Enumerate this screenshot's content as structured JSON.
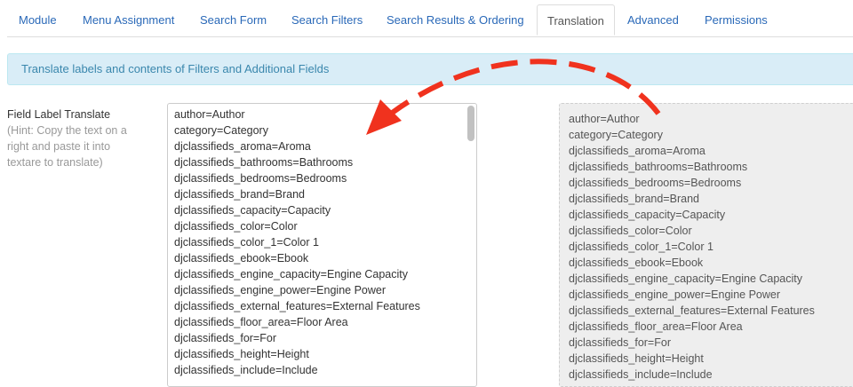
{
  "tabs": [
    {
      "label": "Module"
    },
    {
      "label": "Menu Assignment"
    },
    {
      "label": "Search Form"
    },
    {
      "label": "Search Filters"
    },
    {
      "label": "Search Results & Ordering"
    },
    {
      "label": "Translation"
    },
    {
      "label": "Advanced"
    },
    {
      "label": "Permissions"
    }
  ],
  "active_tab": "Translation",
  "alert": {
    "text": "Translate labels and contents of Filters and Additional Fields"
  },
  "field": {
    "label": "Field Label Translate",
    "hint_lines": [
      "(Hint: Copy the text on a",
      "right and paste it into",
      "textare to translate)"
    ]
  },
  "textarea_lines": [
    "author=Author",
    "category=Category",
    "djclassifieds_aroma=Aroma",
    "djclassifieds_bathrooms=Bathrooms",
    "djclassifieds_bedrooms=Bedrooms",
    "djclassifieds_brand=Brand",
    "djclassifieds_capacity=Capacity",
    "djclassifieds_color=Color",
    "djclassifieds_color_1=Color 1",
    "djclassifieds_ebook=Ebook",
    "djclassifieds_engine_capacity=Engine Capacity",
    "djclassifieds_engine_power=Engine Power",
    "djclassifieds_external_features=External Features",
    "djclassifieds_floor_area=Floor Area",
    "djclassifieds_for=For",
    "djclassifieds_height=Height",
    "djclassifieds_include=Include"
  ],
  "source_lines": [
    "author=Author",
    "category=Category",
    "djclassifieds_aroma=Aroma",
    "djclassifieds_bathrooms=Bathrooms",
    "djclassifieds_bedrooms=Bedrooms",
    "djclassifieds_brand=Brand",
    "djclassifieds_capacity=Capacity",
    "djclassifieds_color=Color",
    "djclassifieds_color_1=Color 1",
    "djclassifieds_ebook=Ebook",
    "djclassifieds_engine_capacity=Engine Capacity",
    "djclassifieds_engine_power=Engine Power",
    "djclassifieds_external_features=External Features",
    "djclassifieds_floor_area=Floor Area",
    "djclassifieds_for=For",
    "djclassifieds_height=Height",
    "djclassifieds_include=Include"
  ],
  "colors": {
    "link": "#2a69b8",
    "alert_bg": "#d9edf7",
    "alert_text": "#3a87ad",
    "arrow": "#f0321e"
  },
  "icons": {
    "arrow": "curved-dashed-arrow-icon"
  }
}
